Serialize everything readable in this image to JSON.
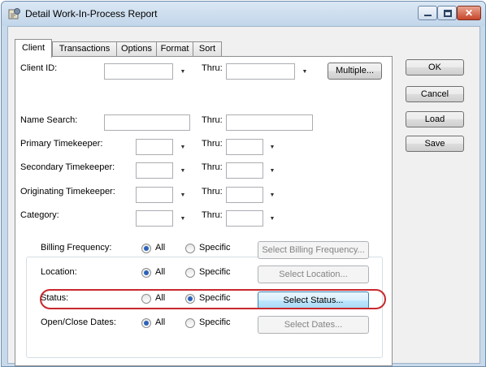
{
  "window": {
    "title": "Detail Work-In-Process Report",
    "close_glyph": "✕"
  },
  "tabs": [
    "Client",
    "Transactions",
    "Options",
    "Format",
    "Sort"
  ],
  "fields": {
    "client_id_label": "Client ID:",
    "thru": "Thru:",
    "multiple_label": "Multiple...",
    "name_search_label": "Name Search:",
    "primary_label": "Primary Timekeeper:",
    "secondary_label": "Secondary Timekeeper:",
    "originating_label": "Originating Timekeeper:",
    "category_label": "Category:",
    "dropdown_glyph": "▼"
  },
  "group": {
    "all_label": "All",
    "specific_label": "Specific",
    "rows": [
      {
        "label": "Billing Frequency:",
        "selected": "all",
        "button": "Select Billing Frequency...",
        "button_enabled": false
      },
      {
        "label": "Location:",
        "selected": "all",
        "button": "Select Location...",
        "button_enabled": false
      },
      {
        "label": "Status:",
        "selected": "specific",
        "button": "Select Status...",
        "button_enabled": true
      },
      {
        "label": "Open/Close Dates:",
        "selected": "all",
        "button": "Select Dates...",
        "button_enabled": false
      }
    ]
  },
  "actions": {
    "ok": "OK",
    "cancel": "Cancel",
    "load": "Load",
    "save": "Save"
  },
  "colors": {
    "highlight": "#c8282d",
    "radio_dot": "#2a63b8"
  }
}
